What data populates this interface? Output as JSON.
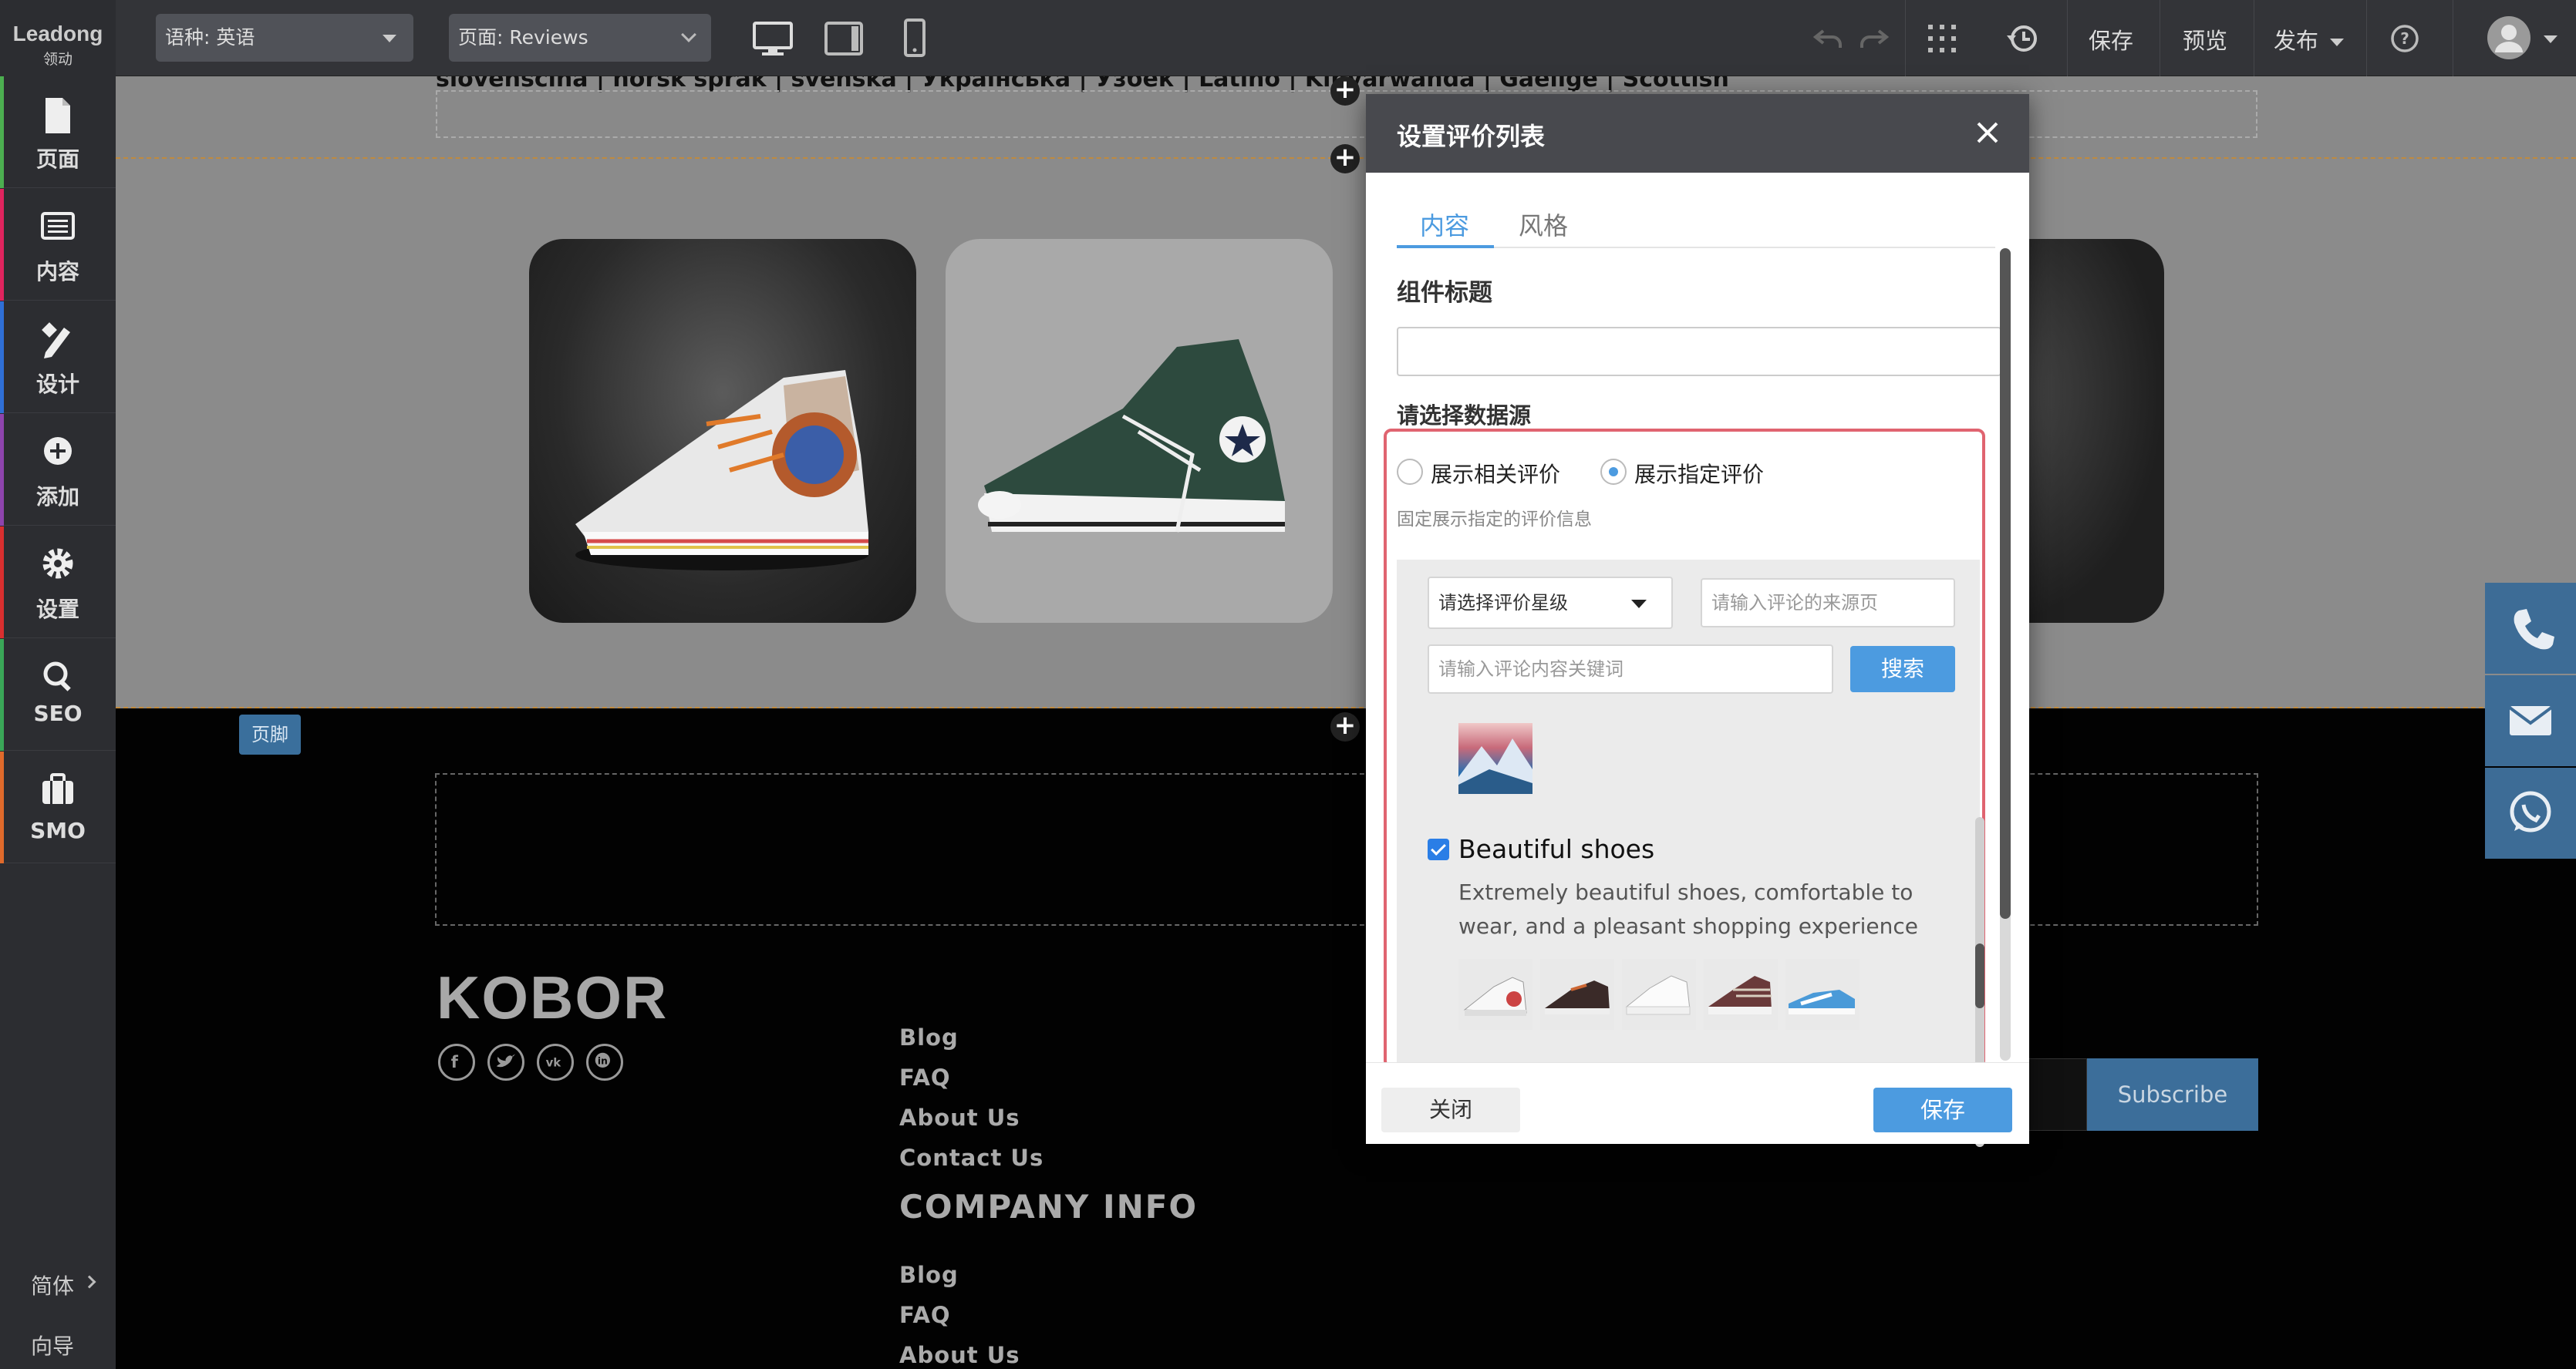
{
  "topbar": {
    "logo_main": "Leadong",
    "logo_sub": "领动",
    "language_select": "语种: 英语",
    "page_select": "页面: Reviews",
    "save": "保存",
    "preview": "预览",
    "publish": "发布"
  },
  "sidebar": {
    "items": [
      {
        "label": "页面",
        "color": "#4caf50"
      },
      {
        "label": "内容",
        "color": "#e0245e"
      },
      {
        "label": "设计",
        "color": "#2f6fd6"
      },
      {
        "label": "添加",
        "color": "#8e44ad"
      },
      {
        "label": "设置",
        "color": "#d92f2f"
      },
      {
        "label": "SEO",
        "color": "#3aa657"
      },
      {
        "label": "SMO",
        "color": "#e06a2b"
      }
    ],
    "lang": "简体",
    "guide": "向导"
  },
  "canvas": {
    "lang_links": "slovenščina | norsk språk | svenska | Українська | Ўзбек | Latino | Kinyarwanda | Gaeilge | Scottish",
    "footer_tag": "页脚",
    "brand": "KOBOR",
    "footer_links_1": [
      "Blog",
      "FAQ",
      "About Us",
      "Contact Us"
    ],
    "company_heading": "COMPANY INFO",
    "footer_links_2": [
      "Blog",
      "FAQ",
      "About Us"
    ],
    "subscribe": "Subscribe"
  },
  "modal": {
    "title": "设置评价列表",
    "tabs": [
      "内容",
      "风格"
    ],
    "component_title_label": "组件标题",
    "component_title_value": "",
    "datasource_label": "请选择数据源",
    "radio_related": "展示相关评价",
    "radio_specified": "展示指定评价",
    "hint": "固定展示指定的评价信息",
    "rating_select": "请选择评价星级",
    "source_placeholder": "请输入评论的来源页",
    "keyword_placeholder": "请输入评论内容关键词",
    "search_button": "搜索",
    "review": {
      "title": "Beautiful shoes",
      "checked": true,
      "description": "Extremely beautiful shoes, comfortable to wear, and a pleasant shopping experience"
    },
    "close_button": "关闭",
    "save_button": "保存"
  }
}
